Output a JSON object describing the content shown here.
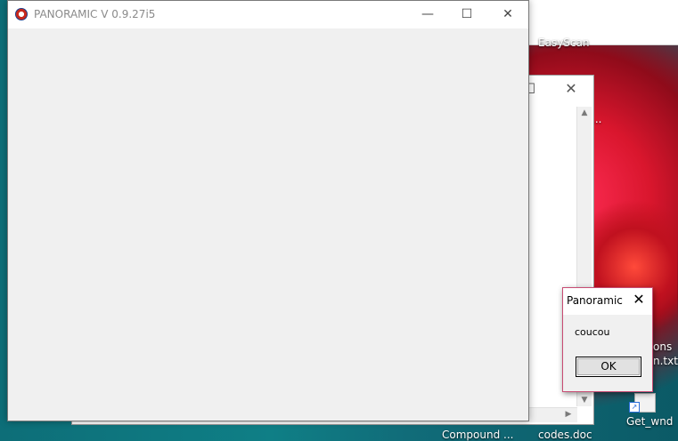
{
  "main_window": {
    "title": "PANORAMIC V 0.9.27i5",
    "minimize_glyph": "—",
    "maximize_glyph": "☐",
    "close_glyph": "✕"
  },
  "background_window": {
    "maximize_glyph": "☐",
    "close_glyph": "✕",
    "scroll_up": "▲",
    "scroll_down": "▼",
    "scroll_left": "◀",
    "scroll_right": "▶"
  },
  "message_box": {
    "title": "Panoramic",
    "close_glyph": "✕",
    "message": "coucou",
    "ok_label": "OK"
  },
  "desktop": {
    "labels": [
      {
        "text": "EasyScan",
        "partial": true
      },
      {
        "text": "..."
      },
      {
        "text": "ons"
      },
      {
        "text": "n.txt"
      },
      {
        "text": "Get_wnd"
      },
      {
        "text": "Compound ..."
      },
      {
        "text": "codes.doc"
      }
    ],
    "shortcut_arrow_glyph": "↗"
  }
}
